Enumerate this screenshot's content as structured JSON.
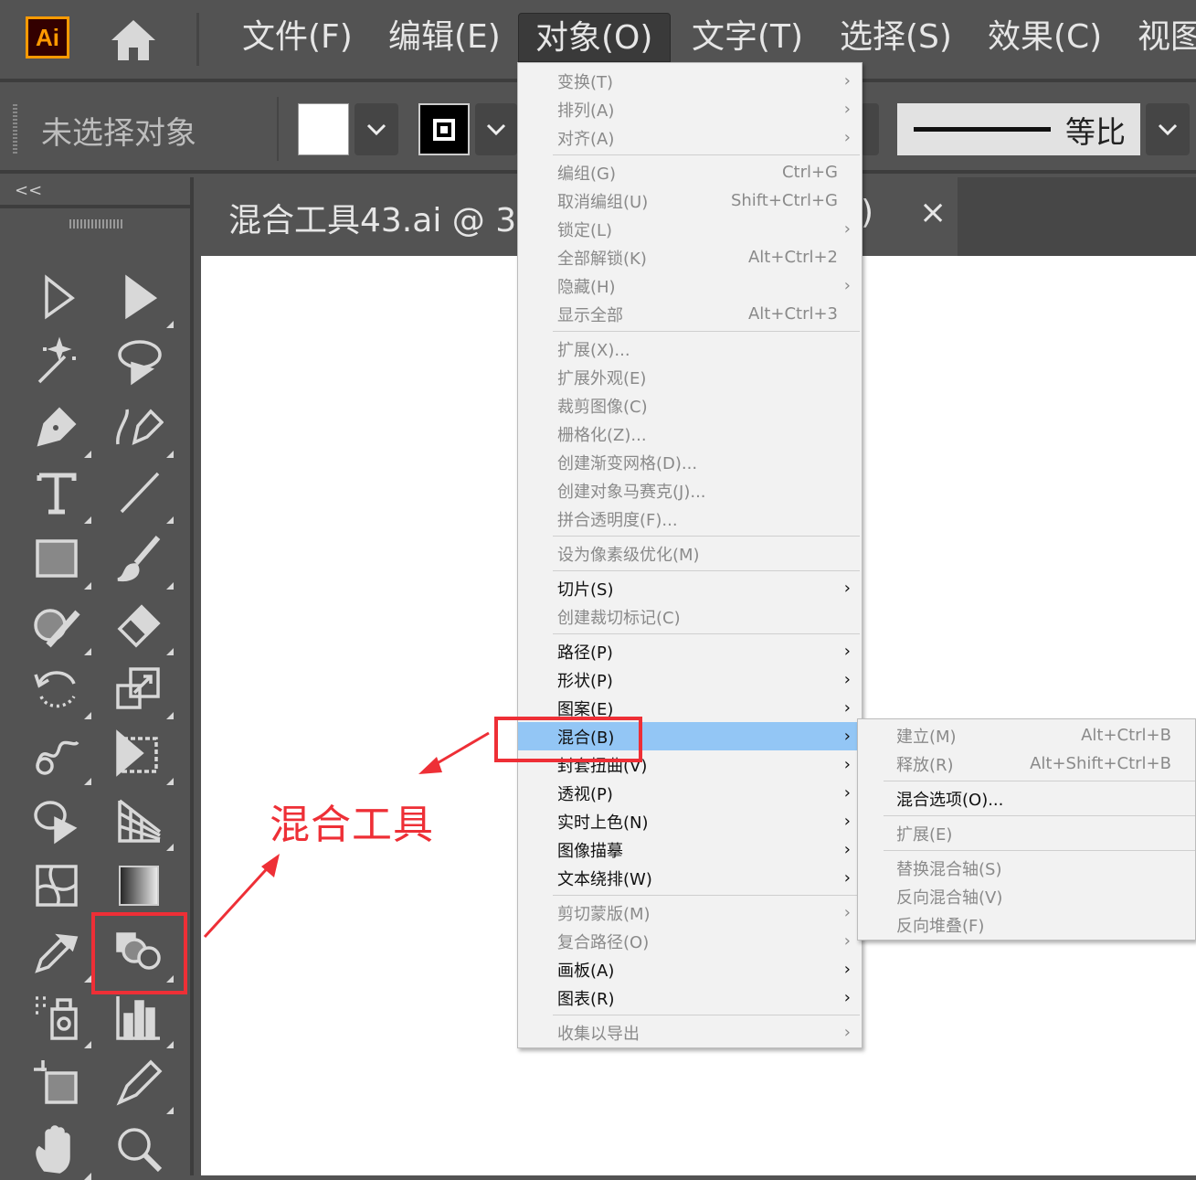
{
  "app": {
    "logo": "Ai",
    "accent": "#ff9a00"
  },
  "menubar": {
    "items": [
      "文件(F)",
      "编辑(E)",
      "对象(O)",
      "文字(T)",
      "选择(S)",
      "效果(C)",
      "视图"
    ],
    "active": "对象(O)"
  },
  "control": {
    "selection_status": "未选择对象",
    "stroke_profile": "等比",
    "fill_color": "#ffffff",
    "stroke_color": "#000000"
  },
  "toolbar": {
    "collapse": "<<"
  },
  "document_tab": {
    "title": "混合工具43.ai @ 3",
    "title_tail": ")",
    "close": "×"
  },
  "object_menu": {
    "groups": [
      [
        {
          "label": "变换(T)",
          "sub": true,
          "enabled": false
        },
        {
          "label": "排列(A)",
          "sub": true,
          "enabled": false
        },
        {
          "label": "对齐(A)",
          "sub": true,
          "enabled": false
        }
      ],
      [
        {
          "label": "编组(G)",
          "shortcut": "Ctrl+G",
          "enabled": false
        },
        {
          "label": "取消编组(U)",
          "shortcut": "Shift+Ctrl+G",
          "enabled": false
        },
        {
          "label": "锁定(L)",
          "sub": true,
          "enabled": false
        },
        {
          "label": "全部解锁(K)",
          "shortcut": "Alt+Ctrl+2",
          "enabled": false
        },
        {
          "label": "隐藏(H)",
          "sub": true,
          "enabled": false
        },
        {
          "label": "显示全部",
          "shortcut": "Alt+Ctrl+3",
          "enabled": false
        }
      ],
      [
        {
          "label": "扩展(X)...",
          "enabled": false
        },
        {
          "label": "扩展外观(E)",
          "enabled": false
        },
        {
          "label": "裁剪图像(C)",
          "enabled": false
        },
        {
          "label": "栅格化(Z)...",
          "enabled": false
        },
        {
          "label": "创建渐变网格(D)...",
          "enabled": false
        },
        {
          "label": "创建对象马赛克(J)...",
          "enabled": false
        },
        {
          "label": "拼合透明度(F)...",
          "enabled": false
        }
      ],
      [
        {
          "label": "设为像素级优化(M)",
          "enabled": false
        }
      ],
      [
        {
          "label": "切片(S)",
          "sub": true,
          "enabled": true
        },
        {
          "label": "创建裁切标记(C)",
          "enabled": false
        }
      ],
      [
        {
          "label": "路径(P)",
          "sub": true,
          "enabled": true
        },
        {
          "label": "形状(P)",
          "sub": true,
          "enabled": true
        },
        {
          "label": "图案(E)",
          "sub": true,
          "enabled": true
        },
        {
          "label": "混合(B)",
          "sub": true,
          "enabled": true,
          "highlighted": true
        },
        {
          "label": "封套扭曲(V)",
          "sub": true,
          "enabled": true
        },
        {
          "label": "透视(P)",
          "sub": true,
          "enabled": true
        },
        {
          "label": "实时上色(N)",
          "sub": true,
          "enabled": true
        },
        {
          "label": "图像描摹",
          "sub": true,
          "enabled": true
        },
        {
          "label": "文本绕排(W)",
          "sub": true,
          "enabled": true
        }
      ],
      [
        {
          "label": "剪切蒙版(M)",
          "sub": true,
          "enabled": false
        },
        {
          "label": "复合路径(O)",
          "sub": true,
          "enabled": false
        },
        {
          "label": "画板(A)",
          "sub": true,
          "enabled": true
        },
        {
          "label": "图表(R)",
          "sub": true,
          "enabled": true
        }
      ],
      [
        {
          "label": "收集以导出",
          "sub": true,
          "enabled": false
        }
      ]
    ]
  },
  "blend_submenu": {
    "groups": [
      [
        {
          "label": "建立(M)",
          "shortcut": "Alt+Ctrl+B",
          "enabled": false
        },
        {
          "label": "释放(R)",
          "shortcut": "Alt+Shift+Ctrl+B",
          "enabled": false
        }
      ],
      [
        {
          "label": "混合选项(O)...",
          "enabled": true
        }
      ],
      [
        {
          "label": "扩展(E)",
          "enabled": false
        }
      ],
      [
        {
          "label": "替换混合轴(S)",
          "enabled": false
        },
        {
          "label": "反向混合轴(V)",
          "enabled": false
        },
        {
          "label": "反向堆叠(F)",
          "enabled": false
        }
      ]
    ]
  },
  "annotation": {
    "label": "混合工具",
    "color": "#ee2f36"
  },
  "menu_highlight_color": "#93c6f5"
}
